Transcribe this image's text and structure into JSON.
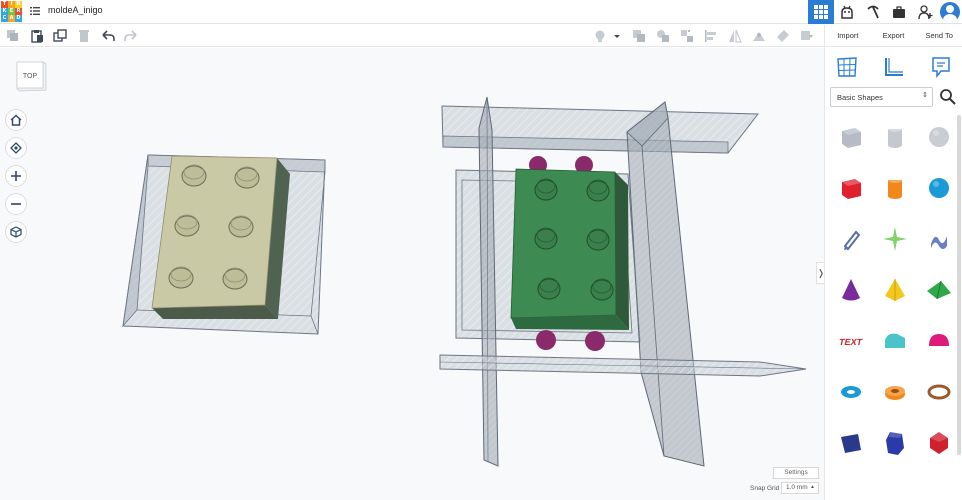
{
  "app": {
    "logo_letters": [
      "T",
      "I",
      "N",
      "K",
      "E",
      "R",
      "C",
      "A",
      "D"
    ],
    "logo_colors": [
      "#e8502c",
      "#f6a623",
      "#f8d028",
      "#2fa8e3",
      "#7cc243",
      "#e8502c",
      "#2fa8e3",
      "#f6a623",
      "#2fa8e3"
    ],
    "design_title": "moldeA_inigo"
  },
  "topbar_icons": [
    "grid-view-icon",
    "gallery-icon",
    "pickaxe-icon",
    "briefcase-icon",
    "add-user-icon",
    "user-avatar"
  ],
  "toolbar": {
    "left_tools": [
      "copy-icon",
      "paste-icon",
      "duplicate-icon",
      "delete-icon",
      "undo-icon",
      "redo-icon"
    ],
    "right_tools": [
      "light-icon",
      "dropdown-icon",
      "group-icon",
      "ungroup-icon",
      "align-icon",
      "mirror-icon",
      "workplane-icon",
      "ruler-icon",
      "notes-icon"
    ]
  },
  "panel": {
    "tabs": [
      "Import",
      "Export",
      "Send To"
    ],
    "category": "Basic Shapes",
    "shapes": [
      {
        "name": "box-hole",
        "color": "#b5bcc6"
      },
      {
        "name": "cylinder-hole",
        "color": "#c4c9d0"
      },
      {
        "name": "sphere-hole",
        "color": "#c8ccd3"
      },
      {
        "name": "box",
        "color": "#e0202c"
      },
      {
        "name": "cylinder",
        "color": "#f0881c"
      },
      {
        "name": "sphere",
        "color": "#1a9ad6"
      },
      {
        "name": "scribble",
        "color": "#5a6fa8"
      },
      {
        "name": "shape-generator",
        "color": "#7fd36a"
      },
      {
        "name": "text-shape",
        "color": "#6b7fc4"
      },
      {
        "name": "cone",
        "color": "#7a2a9a"
      },
      {
        "name": "pyramid",
        "color": "#f2c81c"
      },
      {
        "name": "roof",
        "color": "#2fa84a"
      },
      {
        "name": "text",
        "color": "#d0202c"
      },
      {
        "name": "round-roof",
        "color": "#4ac4c8"
      },
      {
        "name": "half-sphere",
        "color": "#e01a7a"
      },
      {
        "name": "torus",
        "color": "#1a9ad6"
      },
      {
        "name": "tube",
        "color": "#f0881c"
      },
      {
        "name": "ring",
        "color": "#9a5a2a"
      },
      {
        "name": "wedge",
        "color": "#2a3a8a"
      },
      {
        "name": "polygon",
        "color": "#2a3aa8"
      },
      {
        "name": "icosahedron",
        "color": "#d0202c"
      }
    ]
  },
  "workplane": {
    "viewcube_label": "TOP",
    "settings_label": "Settings",
    "snap_label": "Snap Grid",
    "snap_value": "1.0 mm"
  },
  "colors": {
    "accent": "#2b7cd3",
    "brick_beige": "#c9c9a6",
    "brick_green": "#3d8a52",
    "hole_gray": "#a8b0ba",
    "magenta": "#8a2a6a"
  }
}
